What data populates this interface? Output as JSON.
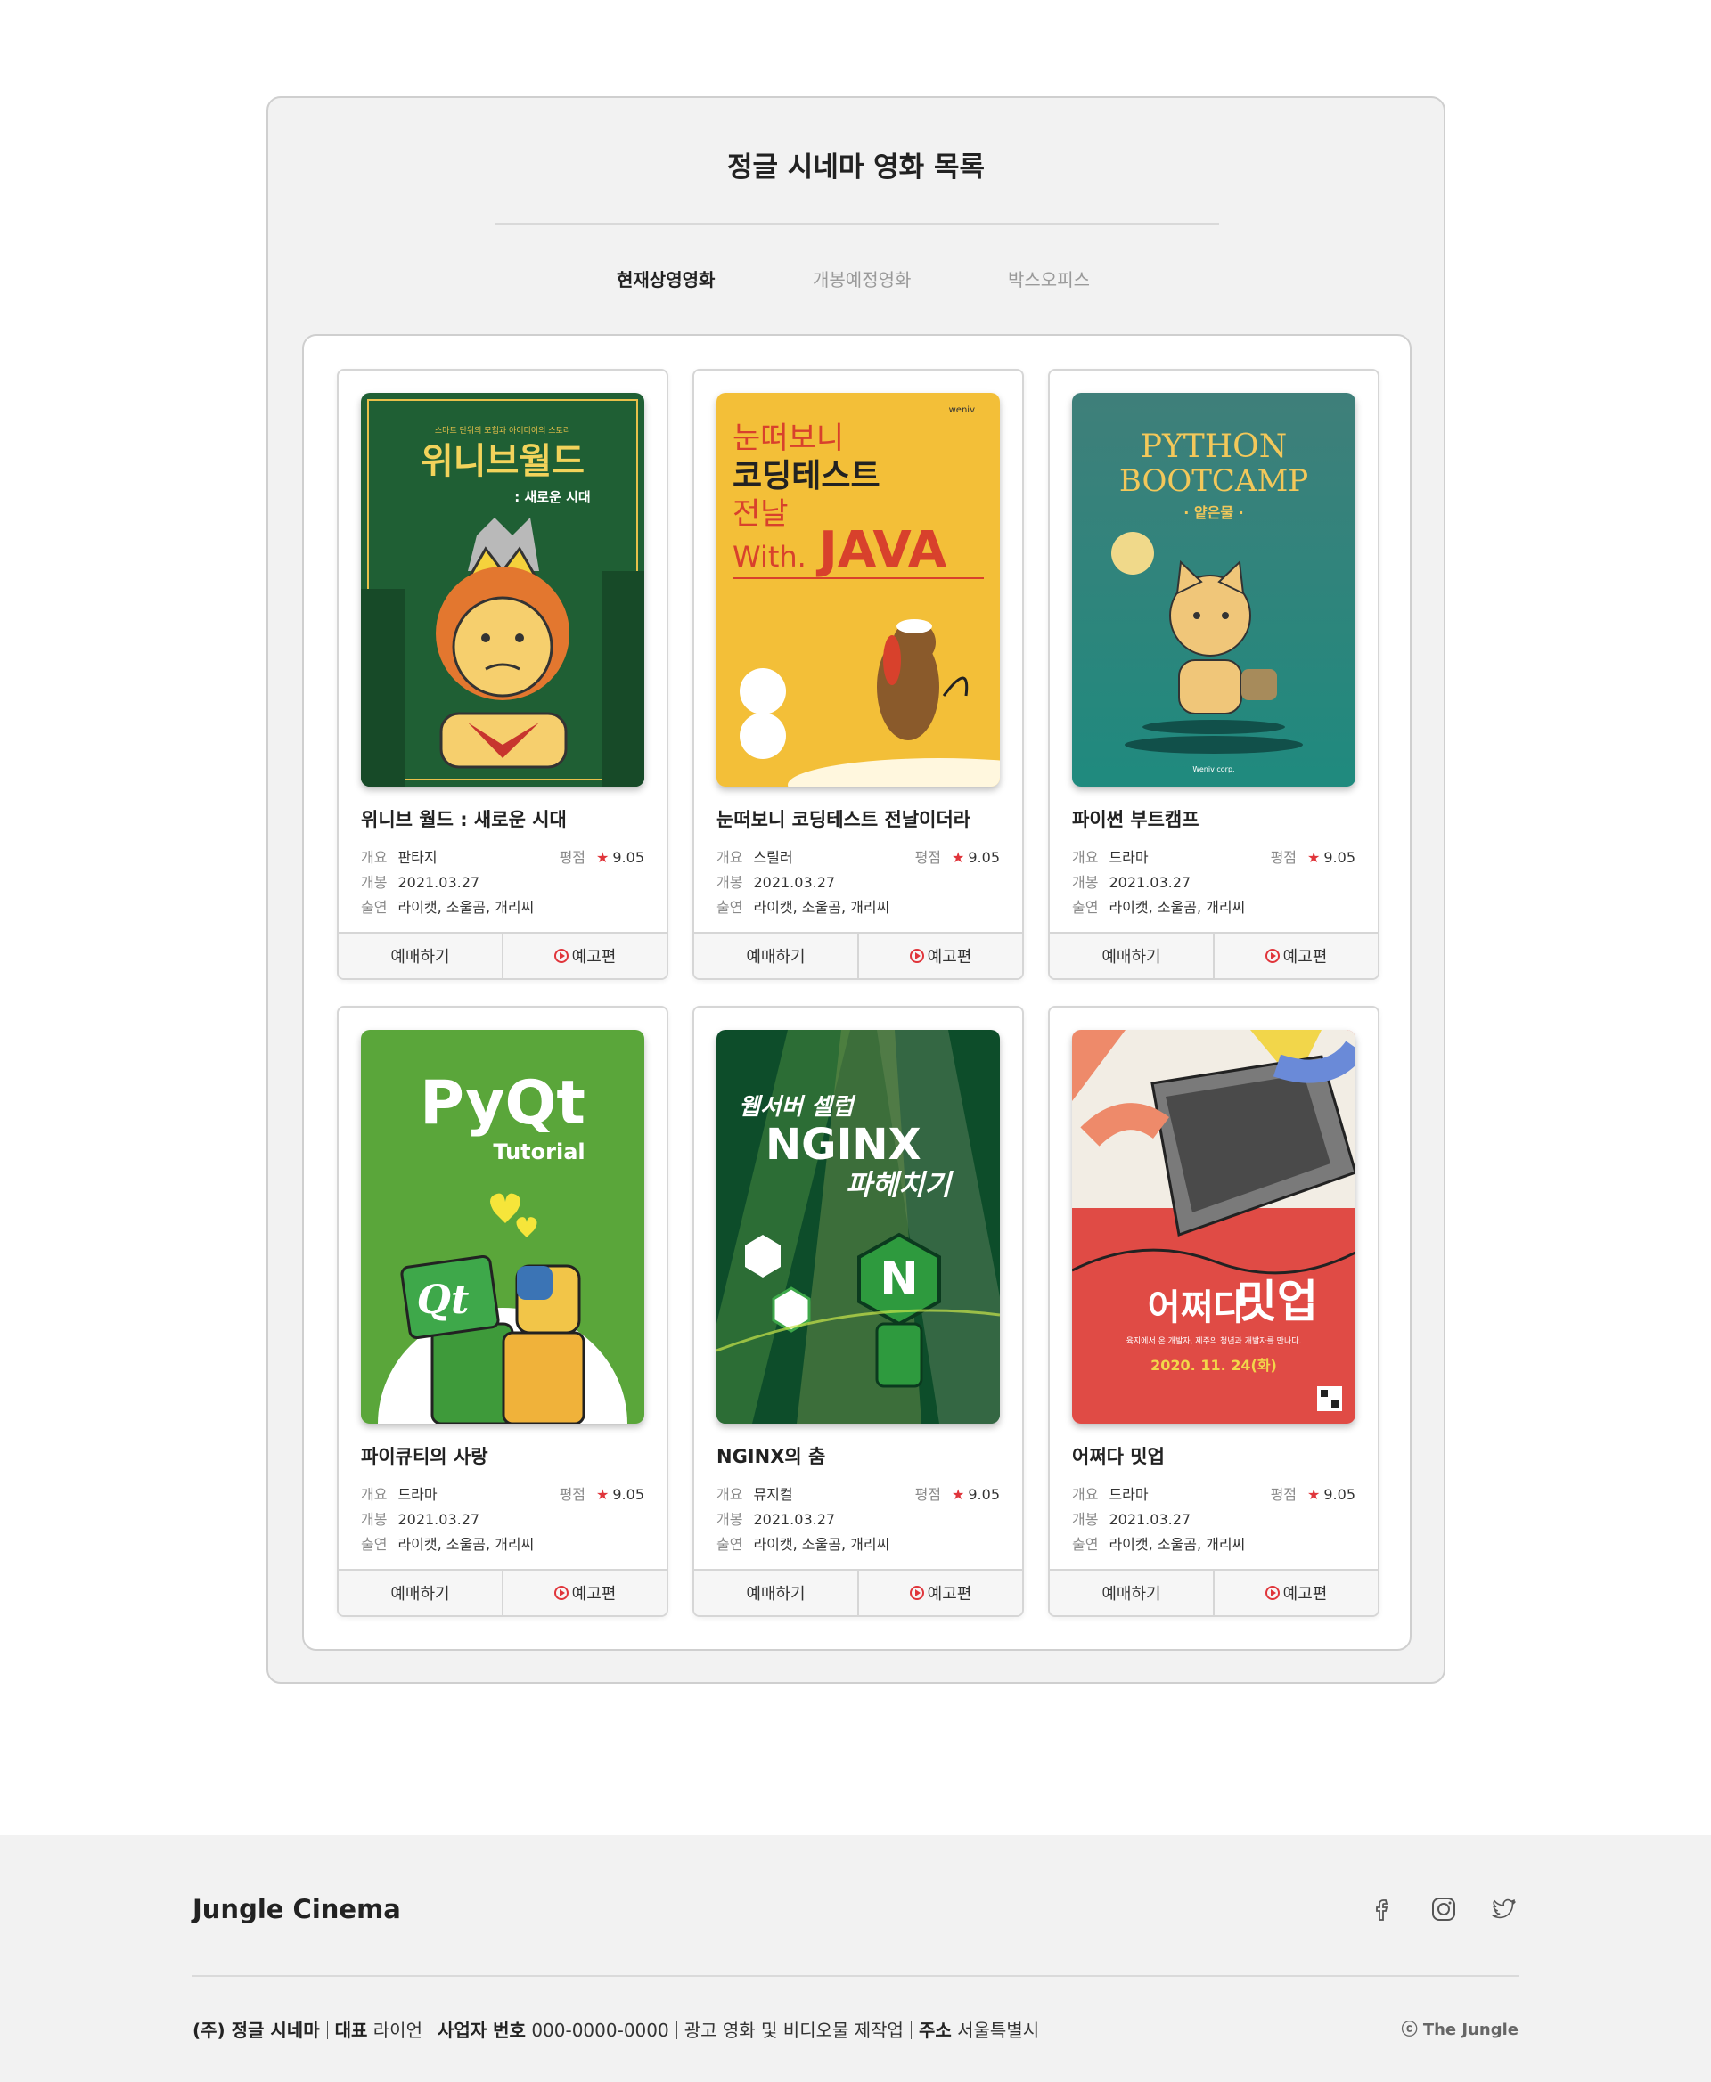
{
  "page": {
    "title": "정글 시네마 영화 목록"
  },
  "tabs": [
    {
      "label": "현재상영영화",
      "active": true
    },
    {
      "label": "개봉예정영화",
      "active": false
    },
    {
      "label": "박스오피스",
      "active": false
    }
  ],
  "labels": {
    "summary": "개요",
    "release": "개봉",
    "cast": "출연",
    "rating": "평점",
    "book": "예매하기",
    "trailer": "예고편"
  },
  "movies": [
    {
      "title": "위니브 월드 : 새로운 시대",
      "genre": "판타지",
      "rating": "9.05",
      "release": "2021.03.27",
      "cast": "라이캣, 소울곰, 개리씨",
      "poster": {
        "tagline": "스마트 단위의 모험과 아이디어의 스토리",
        "title": "위니브월드",
        "subtitle": ": 새로운 시대"
      }
    },
    {
      "title": "눈떠보니 코딩테스트 전날이더라",
      "genre": "스릴러",
      "rating": "9.05",
      "release": "2021.03.27",
      "cast": "라이캣, 소울곰, 개리씨",
      "poster": {
        "brand": "weniv",
        "line1": "눈떠보니",
        "line2": "코딩테스트",
        "line3": "전날",
        "with": "With.",
        "lang": "JAVA"
      }
    },
    {
      "title": "파이썬 부트캠프",
      "genre": "드라마",
      "rating": "9.05",
      "release": "2021.03.27",
      "cast": "라이캣, 소울곰, 개리씨",
      "poster": {
        "line1": "PYTHON",
        "line2": "BOOTCAMP",
        "sub": "· 얕은물 ·",
        "brand": "Weniv corp."
      }
    },
    {
      "title": "파이큐티의 사랑",
      "genre": "드라마",
      "rating": "9.05",
      "release": "2021.03.27",
      "cast": "라이캣, 소울곰, 개리씨",
      "poster": {
        "line1": "PyQt",
        "line2": "Tutorial",
        "qt": "Qt"
      }
    },
    {
      "title": "NGINX의 춤",
      "genre": "뮤지컬",
      "rating": "9.05",
      "release": "2021.03.27",
      "cast": "라이캣, 소울곰, 개리씨",
      "poster": {
        "line1": "웹서버 셀럽",
        "line2": "NGINX",
        "line3": "파헤치기"
      }
    },
    {
      "title": "어쩌다 밋업",
      "genre": "드라마",
      "rating": "9.05",
      "release": "2021.03.27",
      "cast": "라이캣, 소울곰, 개리씨",
      "poster": {
        "line1": "어쩌다",
        "line2": "밋업",
        "desc": "육지에서 온 개발자, 제주의 청년과 개발자를 만나다.",
        "date": "2020. 11. 24(화)"
      }
    }
  ],
  "footer": {
    "brand": "Jungle Cinema",
    "social": [
      "facebook-icon",
      "instagram-icon",
      "twitter-icon"
    ],
    "company": "(주) 정글 시네마",
    "ceo_label": "대표",
    "ceo": "라이언",
    "biz_label": "사업자 번호",
    "biz": "000-0000-0000",
    "business": "광고 영화 및 비디오물 제작업",
    "addr_label": "주소",
    "addr": "서울특별시",
    "copyright": "ⓒ The Jungle"
  },
  "colors": {
    "accent": "#e0353b",
    "panel": "#f2f2f2",
    "border": "#cfcfcf"
  }
}
